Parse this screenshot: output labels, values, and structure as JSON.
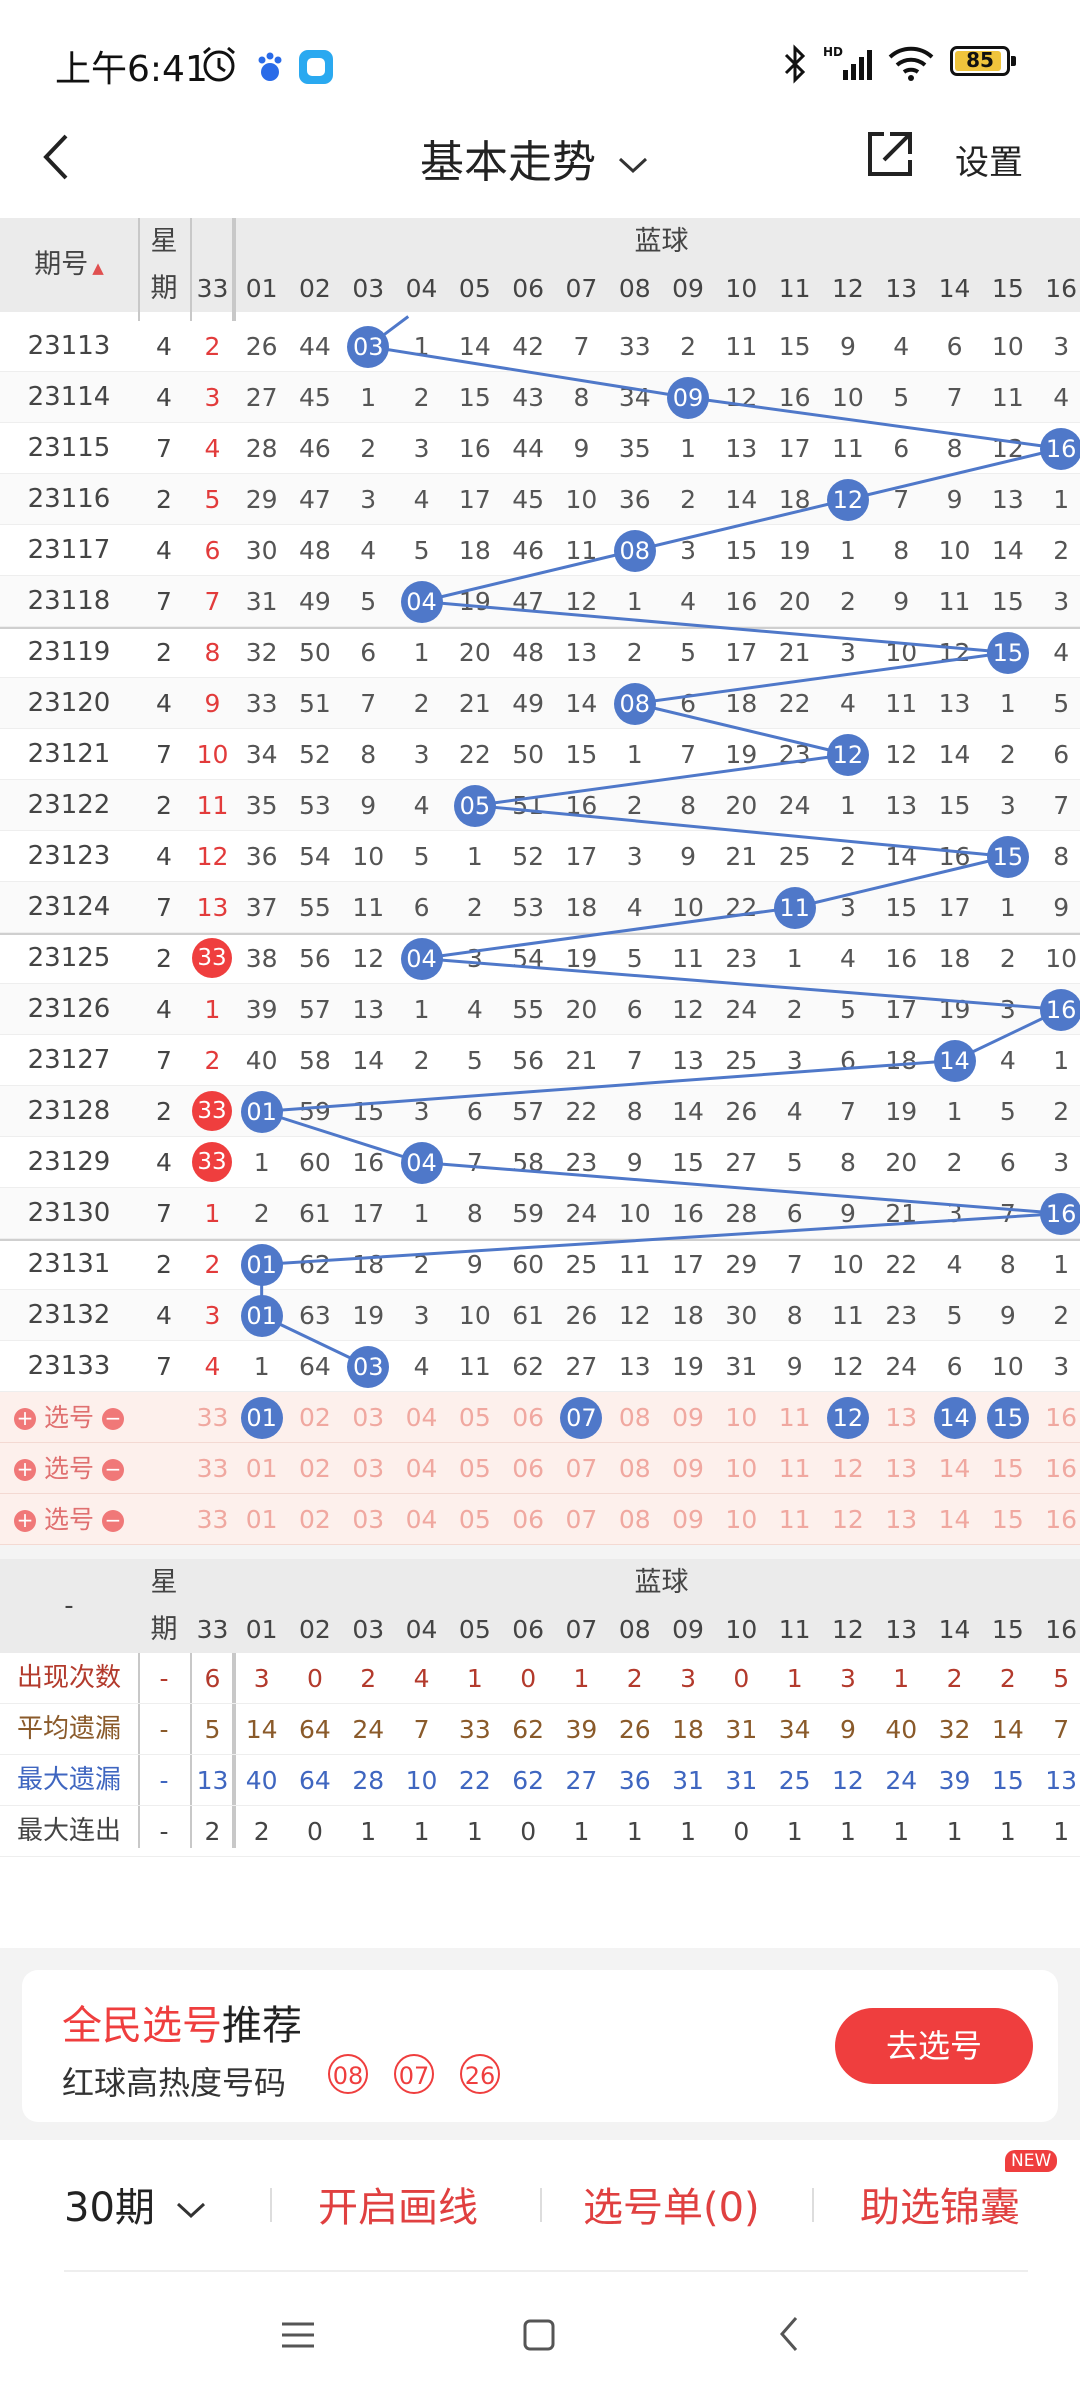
{
  "status_bar": {
    "time": "上午6:41",
    "battery": "85"
  },
  "nav": {
    "title": "基本走势",
    "settings": "设置"
  },
  "header": {
    "period_label": "期号",
    "week_label_top": "星",
    "week_label_bottom": "期",
    "red_col": "33",
    "blue_label": "蓝球",
    "blue_numbers": [
      "01",
      "02",
      "03",
      "04",
      "05",
      "06",
      "07",
      "08",
      "09",
      "10",
      "11",
      "12",
      "13",
      "14",
      "15",
      "16"
    ]
  },
  "rows": [
    {
      "period": "23113",
      "week": "4",
      "red": "2",
      "red_hit": false,
      "vals": [
        "26",
        "44",
        "03",
        "1",
        "14",
        "42",
        "7",
        "33",
        "2",
        "11",
        "15",
        "9",
        "4",
        "6",
        "10",
        "3"
      ],
      "hit": 3
    },
    {
      "period": "23114",
      "week": "4",
      "red": "3",
      "red_hit": false,
      "vals": [
        "27",
        "45",
        "1",
        "2",
        "15",
        "43",
        "8",
        "34",
        "09",
        "12",
        "16",
        "10",
        "5",
        "7",
        "11",
        "4"
      ],
      "hit": 9
    },
    {
      "period": "23115",
      "week": "7",
      "red": "4",
      "red_hit": false,
      "vals": [
        "28",
        "46",
        "2",
        "3",
        "16",
        "44",
        "9",
        "35",
        "1",
        "13",
        "17",
        "11",
        "6",
        "8",
        "12",
        "16"
      ],
      "hit": 16
    },
    {
      "period": "23116",
      "week": "2",
      "red": "5",
      "red_hit": false,
      "vals": [
        "29",
        "47",
        "3",
        "4",
        "17",
        "45",
        "10",
        "36",
        "2",
        "14",
        "18",
        "12",
        "7",
        "9",
        "13",
        "1"
      ],
      "hit": 12
    },
    {
      "period": "23117",
      "week": "4",
      "red": "6",
      "red_hit": false,
      "vals": [
        "30",
        "48",
        "4",
        "5",
        "18",
        "46",
        "11",
        "08",
        "3",
        "15",
        "19",
        "1",
        "8",
        "10",
        "14",
        "2"
      ],
      "hit": 8
    },
    {
      "period": "23118",
      "week": "7",
      "red": "7",
      "red_hit": false,
      "vals": [
        "31",
        "49",
        "5",
        "04",
        "19",
        "47",
        "12",
        "1",
        "4",
        "16",
        "20",
        "2",
        "9",
        "11",
        "15",
        "3"
      ],
      "hit": 4
    },
    {
      "period": "23119",
      "week": "2",
      "red": "8",
      "red_hit": false,
      "vals": [
        "32",
        "50",
        "6",
        "1",
        "20",
        "48",
        "13",
        "2",
        "5",
        "17",
        "21",
        "3",
        "10",
        "12",
        "15",
        "4"
      ],
      "hit": 15
    },
    {
      "period": "23120",
      "week": "4",
      "red": "9",
      "red_hit": false,
      "vals": [
        "33",
        "51",
        "7",
        "2",
        "21",
        "49",
        "14",
        "08",
        "6",
        "18",
        "22",
        "4",
        "11",
        "13",
        "1",
        "5"
      ],
      "hit": 8
    },
    {
      "period": "23121",
      "week": "7",
      "red": "10",
      "red_hit": false,
      "vals": [
        "34",
        "52",
        "8",
        "3",
        "22",
        "50",
        "15",
        "1",
        "7",
        "19",
        "23",
        "12",
        "12",
        "14",
        "2",
        "6"
      ],
      "hit": 12
    },
    {
      "period": "23122",
      "week": "2",
      "red": "11",
      "red_hit": false,
      "vals": [
        "35",
        "53",
        "9",
        "4",
        "05",
        "51",
        "16",
        "2",
        "8",
        "20",
        "24",
        "1",
        "13",
        "15",
        "3",
        "7"
      ],
      "hit": 5
    },
    {
      "period": "23123",
      "week": "4",
      "red": "12",
      "red_hit": false,
      "vals": [
        "36",
        "54",
        "10",
        "5",
        "1",
        "52",
        "17",
        "3",
        "9",
        "21",
        "25",
        "2",
        "14",
        "16",
        "15",
        "8"
      ],
      "hit": 15
    },
    {
      "period": "23124",
      "week": "7",
      "red": "13",
      "red_hit": false,
      "vals": [
        "37",
        "55",
        "11",
        "6",
        "2",
        "53",
        "18",
        "4",
        "10",
        "22",
        "11",
        "3",
        "15",
        "17",
        "1",
        "9"
      ],
      "hit": 11
    },
    {
      "period": "23125",
      "week": "2",
      "red": "33",
      "red_hit": true,
      "vals": [
        "38",
        "56",
        "12",
        "04",
        "3",
        "54",
        "19",
        "5",
        "11",
        "23",
        "1",
        "4",
        "16",
        "18",
        "2",
        "10"
      ],
      "hit": 4
    },
    {
      "period": "23126",
      "week": "4",
      "red": "1",
      "red_hit": false,
      "vals": [
        "39",
        "57",
        "13",
        "1",
        "4",
        "55",
        "20",
        "6",
        "12",
        "24",
        "2",
        "5",
        "17",
        "19",
        "3",
        "16"
      ],
      "hit": 16
    },
    {
      "period": "23127",
      "week": "7",
      "red": "2",
      "red_hit": false,
      "vals": [
        "40",
        "58",
        "14",
        "2",
        "5",
        "56",
        "21",
        "7",
        "13",
        "25",
        "3",
        "6",
        "18",
        "14",
        "4",
        "1"
      ],
      "hit": 14
    },
    {
      "period": "23128",
      "week": "2",
      "red": "33",
      "red_hit": true,
      "vals": [
        "01",
        "59",
        "15",
        "3",
        "6",
        "57",
        "22",
        "8",
        "14",
        "26",
        "4",
        "7",
        "19",
        "1",
        "5",
        "2"
      ],
      "hit": 1
    },
    {
      "period": "23129",
      "week": "4",
      "red": "33",
      "red_hit": true,
      "vals": [
        "1",
        "60",
        "16",
        "04",
        "7",
        "58",
        "23",
        "9",
        "15",
        "27",
        "5",
        "8",
        "20",
        "2",
        "6",
        "3"
      ],
      "hit": 4
    },
    {
      "period": "23130",
      "week": "7",
      "red": "1",
      "red_hit": false,
      "vals": [
        "2",
        "61",
        "17",
        "1",
        "8",
        "59",
        "24",
        "10",
        "16",
        "28",
        "6",
        "9",
        "21",
        "3",
        "7",
        "16"
      ],
      "hit": 16
    },
    {
      "period": "23131",
      "week": "2",
      "red": "2",
      "red_hit": false,
      "vals": [
        "01",
        "62",
        "18",
        "2",
        "9",
        "60",
        "25",
        "11",
        "17",
        "29",
        "7",
        "10",
        "22",
        "4",
        "8",
        "1"
      ],
      "hit": 1
    },
    {
      "period": "23132",
      "week": "4",
      "red": "3",
      "red_hit": false,
      "vals": [
        "01",
        "63",
        "19",
        "3",
        "10",
        "61",
        "26",
        "12",
        "18",
        "30",
        "8",
        "11",
        "23",
        "5",
        "9",
        "2"
      ],
      "hit": 1
    },
    {
      "period": "23133",
      "week": "7",
      "red": "4",
      "red_hit": false,
      "vals": [
        "1",
        "64",
        "03",
        "4",
        "11",
        "62",
        "27",
        "13",
        "19",
        "31",
        "9",
        "12",
        "24",
        "6",
        "10",
        "3"
      ],
      "hit": 3
    }
  ],
  "picks": {
    "label": "选号",
    "red": "33",
    "row1_selected": [
      1,
      7,
      12,
      14,
      15
    ],
    "numbers": [
      "01",
      "02",
      "03",
      "04",
      "05",
      "06",
      "07",
      "08",
      "09",
      "10",
      "11",
      "12",
      "13",
      "14",
      "15",
      "16"
    ]
  },
  "stats_header": {
    "dash": "-",
    "week_top": "星",
    "week_bottom": "期",
    "red_col": "33",
    "blue_label": "蓝球"
  },
  "stats": [
    {
      "label": "出现次数",
      "week": "-",
      "red": "6",
      "vals": [
        "3",
        "0",
        "2",
        "4",
        "1",
        "0",
        "1",
        "2",
        "3",
        "0",
        "1",
        "3",
        "1",
        "2",
        "2",
        "5"
      ],
      "color": "#b33a2c"
    },
    {
      "label": "平均遗漏",
      "week": "-",
      "red": "5",
      "vals": [
        "14",
        "64",
        "24",
        "7",
        "33",
        "62",
        "39",
        "26",
        "18",
        "31",
        "34",
        "9",
        "40",
        "32",
        "14",
        "7"
      ],
      "color": "#8a5a2a"
    },
    {
      "label": "最大遗漏",
      "week": "-",
      "red": "13",
      "vals": [
        "40",
        "64",
        "28",
        "10",
        "22",
        "62",
        "27",
        "36",
        "31",
        "31",
        "25",
        "12",
        "24",
        "39",
        "15",
        "13"
      ],
      "color": "#3f66c0"
    },
    {
      "label": "最大连出",
      "week": "-",
      "red": "2",
      "vals": [
        "2",
        "0",
        "1",
        "1",
        "1",
        "0",
        "1",
        "1",
        "1",
        "0",
        "1",
        "1",
        "1",
        "1",
        "1",
        "1"
      ],
      "color": "#444444"
    }
  ],
  "banner": {
    "title_red": "全民选号",
    "title_black": "推荐",
    "subtitle": "红球高热度号码",
    "hot_numbers": [
      "08",
      "07",
      "26"
    ],
    "button": "去选号"
  },
  "toolbar": {
    "periods": "30期",
    "draw_line": "开启画线",
    "pick_list": "选号单(0)",
    "assist": "助选锦囊",
    "new_badge": "NEW"
  }
}
